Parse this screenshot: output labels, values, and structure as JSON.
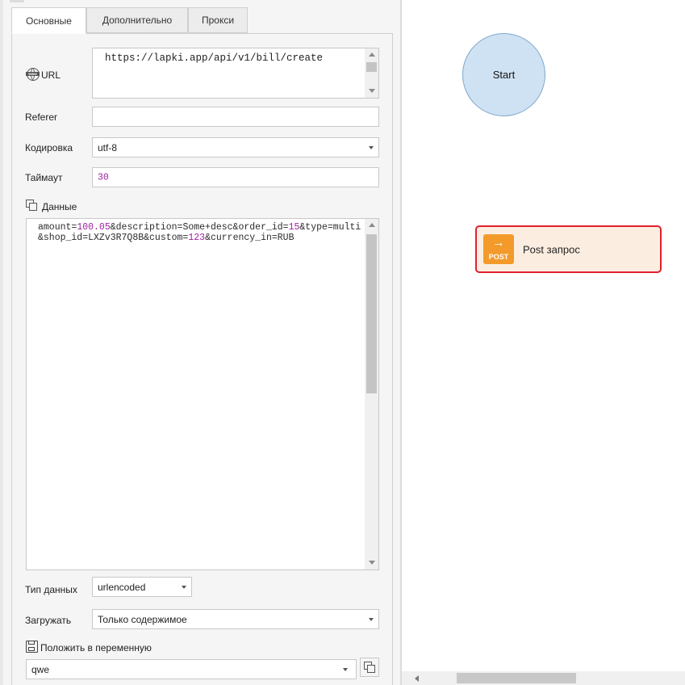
{
  "tabs": {
    "basic": "Основные",
    "additional": "Дополнительно",
    "proxy": "Прокси"
  },
  "form": {
    "url_label": "URL",
    "url_value": "https://lapki.app/api/v1/bill/create",
    "referer_label": "Referer",
    "referer_value": "",
    "encoding_label": "Кодировка",
    "encoding_value": "utf-8",
    "timeout_label": "Таймаут",
    "timeout_value": "30",
    "data_label": "Данные",
    "data_segments": [
      {
        "text": "amount=",
        "type": "text"
      },
      {
        "text": "100.05",
        "type": "num"
      },
      {
        "text": "&description=Some+desc&order_id=",
        "type": "text"
      },
      {
        "text": "15",
        "type": "num"
      },
      {
        "text": "&type=multi&shop_id=LXZv3R7Q8B&custom=",
        "type": "text"
      },
      {
        "text": "123",
        "type": "num"
      },
      {
        "text": "&currency_in=RUB",
        "type": "text"
      }
    ],
    "data_type_label": "Тип данных",
    "data_type_value": "urlencoded",
    "load_label": "Загружать",
    "load_value": "Только содержимое",
    "save_var_label": "Положить в переменную",
    "save_var_value": "qwe"
  },
  "canvas": {
    "start_label": "Start",
    "post_node_label": "Post запрос",
    "post_icon_text": "POST",
    "post_icon_arrow": "→"
  },
  "colors": {
    "start_fill": "#cfe2f3",
    "post_fill": "#fbeee1",
    "post_border": "#e2202e",
    "post_icon": "#f39a2b",
    "number_highlight": "#a020a0"
  },
  "icons": {
    "url": "globe-www-icon",
    "data": "copy-icon",
    "save_var": "save-icon",
    "copy_var": "copy-icon"
  }
}
